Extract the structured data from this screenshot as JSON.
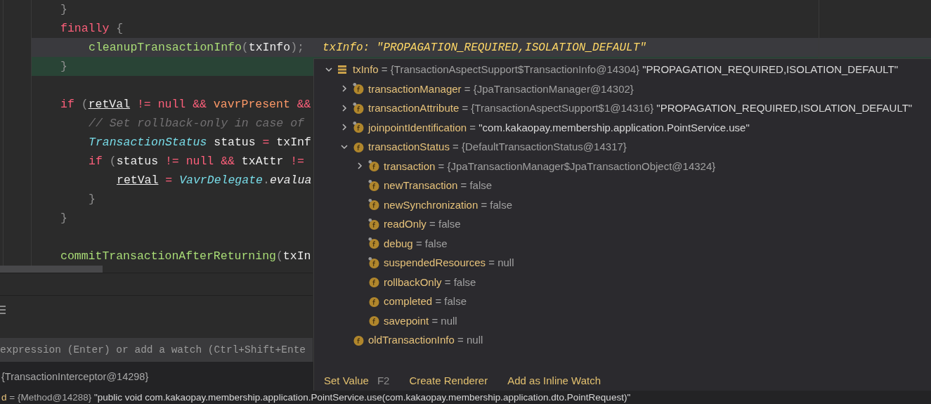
{
  "editor": {
    "lines": [
      {
        "current": false,
        "execution_point": false,
        "tokens": [
          {
            "kind": "punct",
            "text": "}"
          }
        ]
      },
      {
        "current": false,
        "execution_point": false,
        "tokens": [
          {
            "kind": "keyword",
            "text": "finally"
          },
          {
            "kind": "punct",
            "text": " {"
          }
        ],
        "children": [
          {
            "current": true,
            "execution_point": false,
            "tokens": [
              {
                "kind": "method",
                "text": "cleanupTransactionInfo"
              },
              {
                "kind": "punct",
                "text": "("
              },
              {
                "kind": "plain",
                "text": "txInfo"
              },
              {
                "kind": "punct",
                "text": ");"
              }
            ],
            "hint": "txInfo: \"PROPAGATION_REQUIRED,ISOLATION_DEFAULT\""
          }
        ]
      },
      {
        "current": false,
        "execution_point": true,
        "tokens": [
          {
            "kind": "punct",
            "text": "}"
          }
        ]
      },
      {
        "current": false,
        "execution_point": false
      },
      {
        "current": false,
        "execution_point": false,
        "tokens": [
          {
            "kind": "keyword",
            "text": "if"
          },
          {
            "kind": "punct",
            "text": " ("
          },
          {
            "kind": "local",
            "text": "retVal"
          },
          {
            "kind": "keyword",
            "text": " != null &&"
          },
          {
            "kind": "field",
            "text": " vavrPresent"
          },
          {
            "kind": "keyword",
            "text": " &&"
          }
        ],
        "children": [
          {
            "current": false,
            "execution_point": false,
            "tokens": [
              {
                "kind": "comment",
                "text": "// Set rollback-only in case of"
              }
            ]
          },
          {
            "current": false,
            "execution_point": false,
            "tokens": [
              {
                "kind": "type",
                "text": "TransactionStatus"
              },
              {
                "kind": "plain",
                "text": " status"
              },
              {
                "kind": "keyword",
                "text": " ="
              },
              {
                "kind": "plain",
                "text": " txInf"
              }
            ]
          },
          {
            "current": false,
            "execution_point": false,
            "tokens": [
              {
                "kind": "keyword",
                "text": "if"
              },
              {
                "kind": "punct",
                "text": " ("
              },
              {
                "kind": "plain",
                "text": "status"
              },
              {
                "kind": "keyword",
                "text": " != null &&"
              },
              {
                "kind": "plain",
                "text": " txAttr"
              },
              {
                "kind": "keyword",
                "text": " !="
              }
            ],
            "children": [
              {
                "current": false,
                "execution_point": false,
                "tokens": [
                  {
                    "kind": "local",
                    "text": "retVal"
                  },
                  {
                    "kind": "keyword",
                    "text": " = "
                  },
                  {
                    "kind": "type",
                    "text": "VavrDelegate"
                  },
                  {
                    "kind": "punct",
                    "text": "."
                  },
                  {
                    "kind": "static",
                    "text": "evalua"
                  }
                ]
              }
            ]
          },
          {
            "current": false,
            "execution_point": false,
            "tokens": [
              {
                "kind": "punct",
                "text": "}"
              }
            ]
          }
        ]
      },
      {
        "current": false,
        "execution_point": false,
        "tokens": [
          {
            "kind": "punct",
            "text": "}"
          }
        ]
      },
      {
        "current": false,
        "execution_point": false
      },
      {
        "current": false,
        "execution_point": false,
        "tokens": [
          {
            "kind": "method",
            "text": "commitTransactionAfterReturning"
          },
          {
            "kind": "punct",
            "text": "("
          },
          {
            "kind": "plain",
            "text": "txIn"
          }
        ]
      }
    ]
  },
  "evaluate": {
    "placeholder": "expression (Enter) or add a watch (Ctrl+Shift+Ente"
  },
  "variables": [
    {
      "value": "{TransactionInterceptor@14298}"
    },
    {
      "name": "d",
      "value": "= {Method@14288}",
      "string": "\"public void com.kakaopay.membership.application.PointService.use(com.kakaopay.membership.application.dto.PointRequest)\""
    }
  ],
  "popup": {
    "tree": [
      {
        "kind": "object",
        "name": "txInfo",
        "value": "= {TransactionAspectSupport$TransactionInfo@14304}",
        "string": "\"PROPAGATION_REQUIRED,ISOLATION_DEFAULT\"",
        "expanded": true,
        "children": [
          {
            "kind": "field",
            "final": true,
            "expanded": false,
            "name": "transactionManager",
            "value": "= {JpaTransactionManager@14302}"
          },
          {
            "kind": "field",
            "final": true,
            "expanded": false,
            "name": "transactionAttribute",
            "value": "= {TransactionAspectSupport$1@14316}",
            "string": "\"PROPAGATION_REQUIRED,ISOLATION_DEFAULT\""
          },
          {
            "kind": "field",
            "final": true,
            "expanded": false,
            "name": "joinpointIdentification",
            "value": "=",
            "string": "\"com.kakaopay.membership.application.PointService.use\""
          },
          {
            "kind": "field",
            "final": false,
            "expanded": true,
            "name": "transactionStatus",
            "value": "= {DefaultTransactionStatus@14317}",
            "children": [
              {
                "kind": "field",
                "final": true,
                "expanded": false,
                "name": "transaction",
                "value": "= {JpaTransactionManager$JpaTransactionObject@14324}"
              },
              {
                "kind": "field",
                "final": true,
                "name": "newTransaction",
                "value": "= false"
              },
              {
                "kind": "field",
                "final": true,
                "name": "newSynchronization",
                "value": "= false"
              },
              {
                "kind": "field",
                "final": true,
                "name": "readOnly",
                "value": "= false"
              },
              {
                "kind": "field",
                "final": true,
                "name": "debug",
                "value": "= false"
              },
              {
                "kind": "field",
                "final": true,
                "name": "suspendedResources",
                "value": "= null"
              },
              {
                "kind": "field",
                "final": false,
                "name": "rollbackOnly",
                "value": "= false"
              },
              {
                "kind": "field",
                "final": false,
                "name": "completed",
                "value": "= false"
              },
              {
                "kind": "field",
                "final": false,
                "name": "savepoint",
                "value": "= null"
              }
            ]
          },
          {
            "kind": "field",
            "final": false,
            "name": "oldTransactionInfo",
            "value": "= null"
          }
        ]
      }
    ],
    "actions": [
      {
        "label": "Set Value",
        "shortcut": "F2"
      },
      {
        "label": "Create Renderer"
      },
      {
        "label": "Add as Inline Watch"
      }
    ]
  }
}
